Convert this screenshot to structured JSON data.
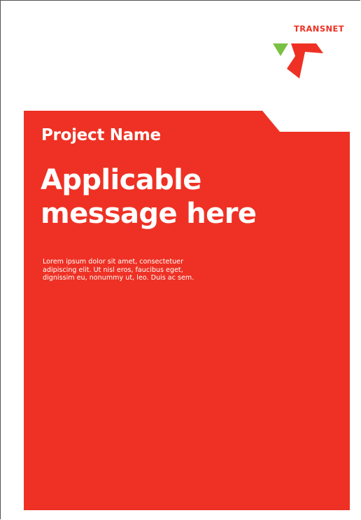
{
  "brand": {
    "wordmark": "TRANSNET",
    "accent_color": "#ee3124",
    "green_color": "#7ac143"
  },
  "cover": {
    "project_name": "Project Name",
    "headline_lines": [
      "Applicable",
      "message here"
    ],
    "body_lines": [
      "Lorem ipsum dolor sit amet, consectetuer",
      "adipiscing elit. Ut nisl eros, faucibus eget,",
      "dignissim eu, nonummy ut, leo. Duis ac sem."
    ],
    "panel_color": "#ee3124"
  }
}
